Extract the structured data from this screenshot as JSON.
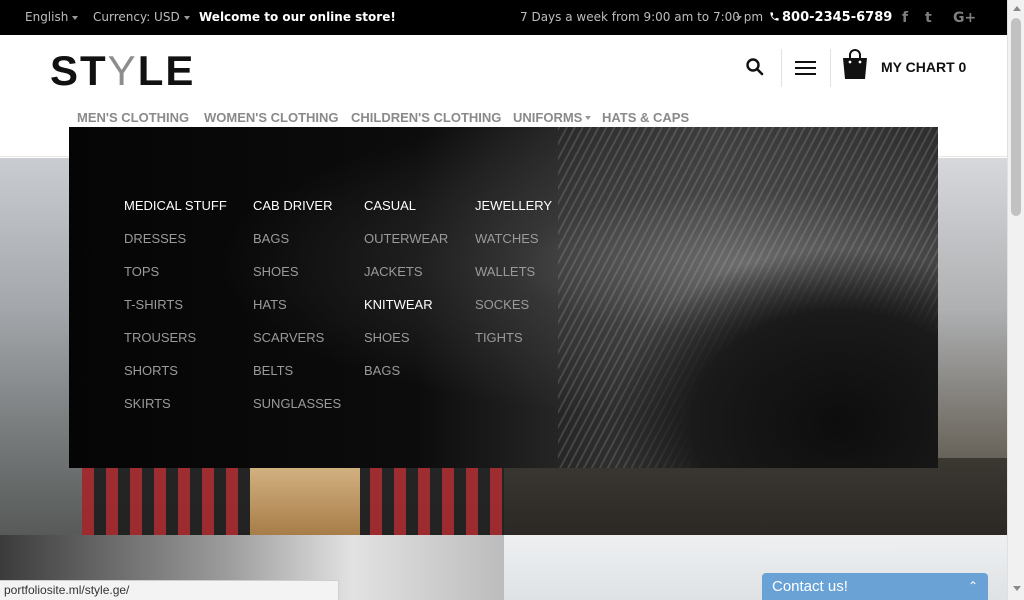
{
  "topbar": {
    "language": "English",
    "currency": "Currency: USD",
    "welcome": "Welcome to our online store!",
    "hours": "7 Days a week from 9:00 am to 7:00 pm",
    "phone": "800-2345-6789",
    "social": {
      "facebook": "f",
      "twitter": "t",
      "googleplus": "G+"
    }
  },
  "header": {
    "logo_part1": "ST",
    "logo_part2": "Y",
    "logo_part3": "LE",
    "cart_label": "MY CHART 0"
  },
  "nav": {
    "items": [
      {
        "label": "MEN'S CLOTHING"
      },
      {
        "label": "WOMEN'S CLOTHING"
      },
      {
        "label": "CHILDREN'S CLOTHING"
      },
      {
        "label": "UNIFORMS"
      },
      {
        "label": "HATS & CAPS"
      }
    ]
  },
  "mega_menu": {
    "columns": [
      {
        "heading": "MEDICAL STUFF",
        "items": [
          "DRESSES",
          "TOPS",
          "T-SHIRTS",
          "TROUSERS",
          "SHORTS",
          "SKIRTS"
        ]
      },
      {
        "heading": "CAB DRIVER",
        "items": [
          "BAGS",
          "SHOES",
          "HATS",
          "SCARVERS",
          "BELTS",
          "SUNGLASSES"
        ]
      },
      {
        "heading": "CASUAL",
        "items": [
          "OUTERWEAR",
          "JACKETS",
          "KNITWEAR",
          "SHOES",
          "BAGS"
        ]
      },
      {
        "heading": "JEWELLERY",
        "items": [
          "WATCHES",
          "WALLETS",
          "SOCKES",
          "TIGHTS"
        ]
      }
    ]
  },
  "status_url": "portfoliosite.ml/style.ge/",
  "contact": {
    "label": "Contact us!"
  }
}
